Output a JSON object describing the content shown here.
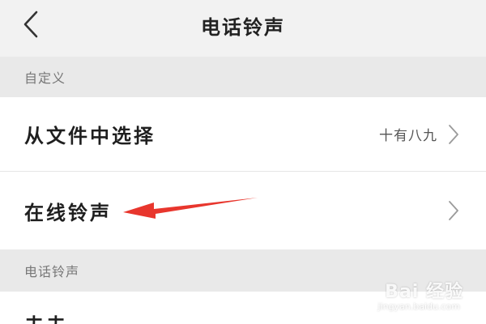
{
  "header": {
    "title": "电话铃声",
    "back_icon": "chevron-left-icon"
  },
  "sections": {
    "custom": {
      "title": "自定义",
      "rows": [
        {
          "label": "从文件中选择",
          "value": "十有八九",
          "icon": "chevron-right-icon"
        },
        {
          "label": "在线铃声",
          "icon": "chevron-right-icon"
        }
      ]
    },
    "ringtone": {
      "title": "电话铃声",
      "partial_row_label": "夫夫"
    }
  },
  "annotation": {
    "color": "#e8362d",
    "icon": "red-arrow-pointing-left"
  },
  "watermark": {
    "main": "Bai 经验",
    "sub": "jingyan.baidu.com"
  },
  "colors": {
    "background": "#f2f2f2",
    "section_bg": "#e9e9e9",
    "row_bg": "#ffffff",
    "arrow": "#e8362d"
  }
}
